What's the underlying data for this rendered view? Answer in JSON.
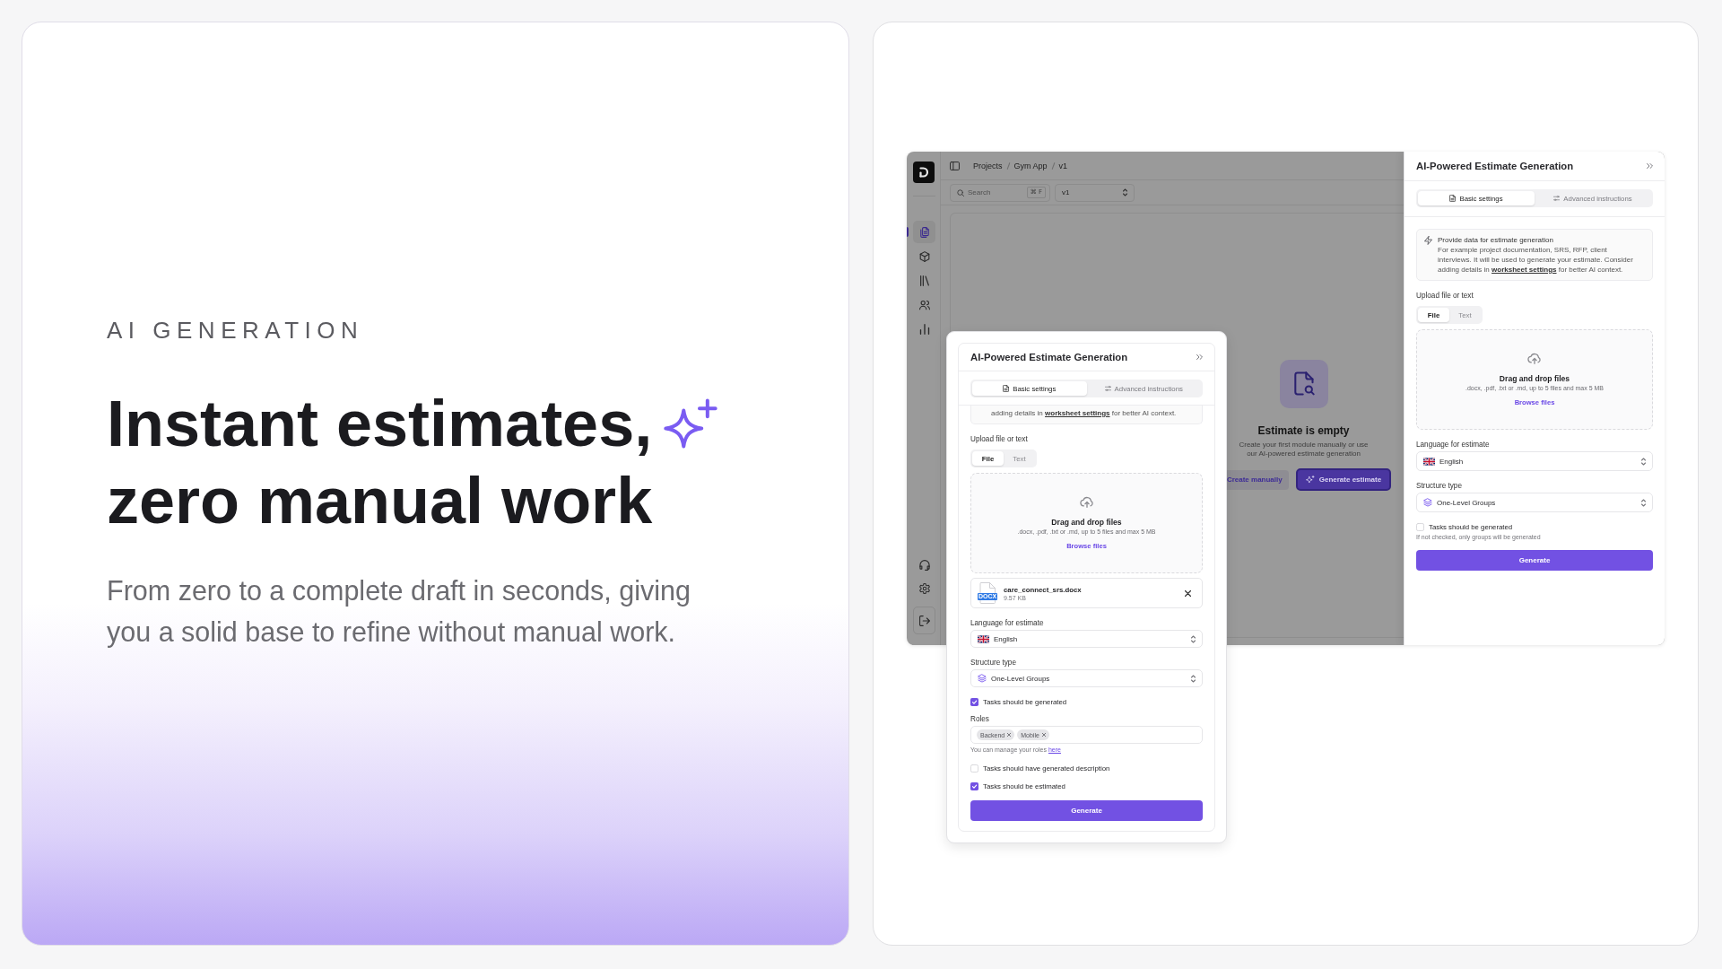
{
  "promo": {
    "eyebrow": "AI GENERATION",
    "headline": [
      "Instant estimates,",
      "zero manual work"
    ],
    "description": "From zero to a complete draft in seconds, giving you a solid base to refine without manual work."
  },
  "app": {
    "sidebar": {
      "items": [
        {
          "kind": "documents",
          "selected": true
        },
        {
          "kind": "cube",
          "selected": false
        },
        {
          "kind": "library",
          "selected": false
        },
        {
          "kind": "users",
          "selected": false
        },
        {
          "kind": "chart",
          "selected": false
        }
      ],
      "bottom_items": [
        {
          "kind": "support"
        },
        {
          "kind": "settings"
        },
        {
          "kind": "logout"
        }
      ]
    },
    "breadcrumbs": [
      "Projects",
      "Gym App",
      "v1"
    ],
    "search": {
      "placeholder": "Search",
      "shortcut": "⌘ F"
    },
    "version_select": {
      "value": "v1"
    },
    "empty_state": {
      "title": "Estimate is empty",
      "description": "Create your first module manually or use our AI-powered estimate generation",
      "buttons": [
        {
          "kind": "secondary",
          "label": "Create manually"
        },
        {
          "kind": "primary",
          "label": "Generate estimate"
        }
      ]
    },
    "side_panel": {
      "title": "AI-Powered Estimate Generation",
      "tabs": [
        {
          "kind": "document",
          "label": "Basic settings",
          "selected": true
        },
        {
          "kind": "sliders",
          "label": "Advanced instructions",
          "selected": false
        }
      ],
      "info": {
        "title": "Provide data for estimate generation",
        "text": "For example project documentation, SRS, RFP, client interviews. It will be used to generate your estimate. Consider adding details in",
        "link": "worksheet settings",
        "text_after": "for better AI context."
      },
      "sections": [
        {
          "kind": "upload",
          "label": "Upload file or text",
          "modes": [
            {
              "label": "File",
              "selected": true
            },
            {
              "label": "Text",
              "selected": false
            }
          ],
          "drop_title": "Drag and drop files",
          "drop_hint": ".docx, .pdf, .txt or .md, up to 5 files and max 5 MB",
          "browse_link": "Browse files"
        },
        {
          "kind": "language_select",
          "label": "Language for estimate",
          "value": "English"
        },
        {
          "kind": "structure_select",
          "label": "Structure type",
          "value": "One-Level Groups"
        },
        {
          "kind": "checkbox",
          "label": "Tasks should be generated",
          "checked": false,
          "hint": "If not checked, only groups will be generated"
        },
        {
          "kind": "button",
          "label": "Generate"
        }
      ]
    }
  },
  "floating_panel": {
    "title": "AI-Powered Estimate Generation",
    "tabs": [
      {
        "kind": "document",
        "label": "Basic settings",
        "selected": true
      },
      {
        "kind": "sliders",
        "label": "Advanced instructions",
        "selected": false
      }
    ],
    "info": {
      "text": "adding details in",
      "link": "worksheet settings",
      "text_after": "for better AI context."
    },
    "sections": [
      {
        "kind": "upload",
        "label": "Upload file or text",
        "modes": [
          {
            "label": "File",
            "selected": true
          },
          {
            "label": "Text",
            "selected": false
          }
        ],
        "drop_title": "Drag and drop files",
        "drop_hint": ".docx, .pdf, .txt or .md, up to 5 files and max 5 MB",
        "browse_link": "Browse files"
      },
      {
        "kind": "file",
        "type_label": "DOCX",
        "name": "care_connect_srs.docx",
        "size": "9.57 KB"
      },
      {
        "kind": "language_select",
        "label": "Language for estimate",
        "value": "English"
      },
      {
        "kind": "structure_select",
        "label": "Structure type",
        "value": "One-Level Groups"
      },
      {
        "kind": "checkbox",
        "label": "Tasks should be generated",
        "checked": true
      },
      {
        "kind": "roles",
        "label": "Roles",
        "chips": [
          "Backend",
          "Mobile"
        ],
        "hint": "You can manage your roles",
        "hint_link": "here"
      },
      {
        "kind": "checkbox",
        "label": "Tasks should have generated description",
        "checked": false
      },
      {
        "kind": "checkbox",
        "label": "Tasks should be estimated",
        "checked": true
      },
      {
        "kind": "button",
        "label": "Generate"
      }
    ]
  }
}
